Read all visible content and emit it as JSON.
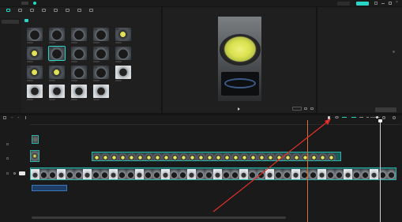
{
  "app": {
    "logo": "",
    "title": "",
    "tab": "",
    "window_controls": [
      "min",
      "max",
      "close"
    ],
    "accent": "#2ad6c6",
    "export_color": "#2ad6c6"
  },
  "media": {
    "toolbar": [
      {
        "label": "",
        "icon": "media-icon"
      },
      {
        "label": "",
        "icon": "audio-icon"
      },
      {
        "label": "",
        "icon": "text-icon"
      },
      {
        "label": "",
        "icon": "sticker-icon"
      },
      {
        "label": "",
        "icon": "effects-icon"
      },
      {
        "label": "",
        "icon": "transition-icon"
      },
      {
        "label": "",
        "icon": "filter-icon"
      },
      {
        "label": "",
        "icon": "adjust-icon"
      }
    ],
    "side": [
      "",
      ""
    ],
    "sort_label": "",
    "thumbs": [
      {
        "kind": "pan",
        "label": "",
        "added": true
      },
      {
        "kind": "pan",
        "label": "",
        "added": true
      },
      {
        "kind": "pan",
        "label": "",
        "added": true
      },
      {
        "kind": "pan",
        "label": "",
        "added": true
      },
      {
        "kind": "egg",
        "label": "",
        "added": true
      },
      {
        "kind": "egg",
        "label": "",
        "added": false
      },
      {
        "kind": "pan",
        "label": "",
        "added": true
      },
      {
        "kind": "pan",
        "label": "",
        "added": false
      },
      {
        "kind": "pan",
        "label": "",
        "added": true
      },
      {
        "kind": "pan",
        "label": "",
        "added": false
      },
      {
        "kind": "egg",
        "label": "",
        "added": true
      },
      {
        "kind": "egg",
        "label": "",
        "added": false
      },
      {
        "kind": "pan",
        "label": "",
        "added": false
      },
      {
        "kind": "pan",
        "label": "",
        "added": true
      },
      {
        "kind": "lt",
        "label": "",
        "added": false
      },
      {
        "kind": "lt",
        "label": "",
        "added": false
      },
      {
        "kind": "lt",
        "label": "",
        "added": false
      },
      {
        "kind": "lt",
        "label": "",
        "added": false
      },
      {
        "kind": "lt",
        "label": "",
        "added": false
      }
    ]
  },
  "player": {
    "title": "",
    "timecode": "",
    "ratio_label": ""
  },
  "properties": {
    "title": "",
    "rows": [
      {
        "key": "",
        "value": ""
      },
      {
        "key": "",
        "value": ""
      },
      {
        "key": "",
        "value": ""
      },
      {
        "key": "",
        "value": ""
      },
      {
        "key": "",
        "value": ""
      },
      {
        "key": "",
        "value": ""
      }
    ],
    "button": ""
  },
  "timeline": {
    "ruler_ticks": [
      "",
      "",
      "",
      "",
      "",
      "",
      "",
      "",
      "",
      "",
      "",
      ""
    ],
    "video_clip_text": "",
    "audio_label": ""
  }
}
